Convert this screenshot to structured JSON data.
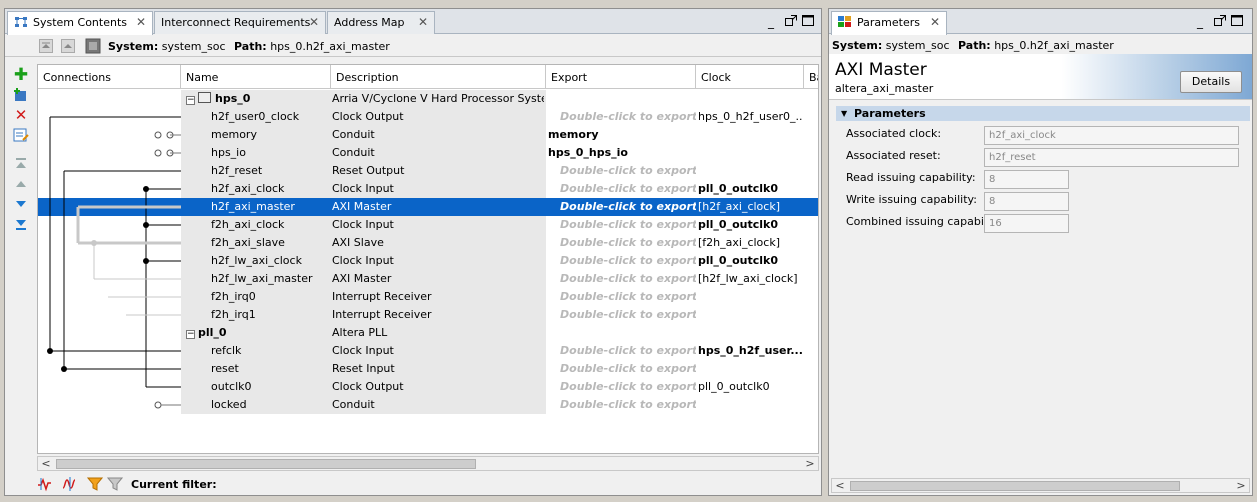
{
  "left": {
    "tabs": [
      {
        "label": "System Contents",
        "active": true
      },
      {
        "label": "Interconnect Requirements",
        "active": false
      },
      {
        "label": "Address Map",
        "active": false
      }
    ],
    "system_label": "System:",
    "system_value": "system_soc",
    "path_label": "Path:",
    "path_value": "hps_0.h2f_axi_master",
    "columns": [
      "Connections",
      "Name",
      "Description",
      "Export",
      "Clock",
      "Ba"
    ],
    "rows": [
      {
        "name": "hps_0",
        "desc": "Arria V/Cyclone V Hard Processor System",
        "export": "",
        "clock": "",
        "group": true
      },
      {
        "name": "h2f_user0_clock",
        "desc": "Clock Output",
        "export": "Double-click to export",
        "clock": "hps_0_h2f_user0_..."
      },
      {
        "name": "memory",
        "desc": "Conduit",
        "export": "memory",
        "clock": ""
      },
      {
        "name": "hps_io",
        "desc": "Conduit",
        "export": "hps_0_hps_io",
        "clock": ""
      },
      {
        "name": "h2f_reset",
        "desc": "Reset Output",
        "export": "Double-click to export",
        "clock": ""
      },
      {
        "name": "h2f_axi_clock",
        "desc": "Clock Input",
        "export": "Double-click to export",
        "clock": "pll_0_outclk0"
      },
      {
        "name": "h2f_axi_master",
        "desc": "AXI Master",
        "export": "Double-click to export",
        "clock": "[h2f_axi_clock]",
        "selected": true
      },
      {
        "name": "f2h_axi_clock",
        "desc": "Clock Input",
        "export": "Double-click to export",
        "clock": "pll_0_outclk0"
      },
      {
        "name": "f2h_axi_slave",
        "desc": "AXI Slave",
        "export": "Double-click to export",
        "clock": "[f2h_axi_clock]"
      },
      {
        "name": "h2f_lw_axi_clock",
        "desc": "Clock Input",
        "export": "Double-click to export",
        "clock": "pll_0_outclk0"
      },
      {
        "name": "h2f_lw_axi_master",
        "desc": "AXI Master",
        "export": "Double-click to export",
        "clock": "[h2f_lw_axi_clock]"
      },
      {
        "name": "f2h_irq0",
        "desc": "Interrupt Receiver",
        "export": "Double-click to export",
        "clock": ""
      },
      {
        "name": "f2h_irq1",
        "desc": "Interrupt Receiver",
        "export": "Double-click to export",
        "clock": ""
      },
      {
        "name": "pll_0",
        "desc": "Altera PLL",
        "export": "",
        "clock": "",
        "group": true
      },
      {
        "name": "refclk",
        "desc": "Clock Input",
        "export": "Double-click to export",
        "clock": "hps_0_h2f_user..."
      },
      {
        "name": "reset",
        "desc": "Reset Input",
        "export": "Double-click to export",
        "clock": ""
      },
      {
        "name": "outclk0",
        "desc": "Clock Output",
        "export": "Double-click to export",
        "clock": "pll_0_outclk0"
      },
      {
        "name": "locked",
        "desc": "Conduit",
        "export": "Double-click to export",
        "clock": ""
      }
    ],
    "filter_label": "Current filter:"
  },
  "right": {
    "tab": "Parameters",
    "system_label": "System:",
    "system_value": "system_soc",
    "path_label": "Path:",
    "path_value": "hps_0.h2f_axi_master",
    "title": "AXI Master",
    "subtitle": "altera_axi_master",
    "details_button": "Details",
    "section": "Parameters",
    "params": [
      {
        "label": "Associated clock:",
        "value": "h2f_axi_clock"
      },
      {
        "label": "Associated reset:",
        "value": "h2f_reset"
      },
      {
        "label": "Read issuing capability:",
        "value": "8"
      },
      {
        "label": "Write issuing capability:",
        "value": "8"
      },
      {
        "label": "Combined issuing capability:",
        "value": "16"
      }
    ]
  },
  "colors": {
    "selection": "#0a64c8",
    "section_header": "#c6d7ea",
    "add_green": "#1aa01a",
    "remove_red": "#d11a1a",
    "arrow_blue": "#1b78d0"
  }
}
